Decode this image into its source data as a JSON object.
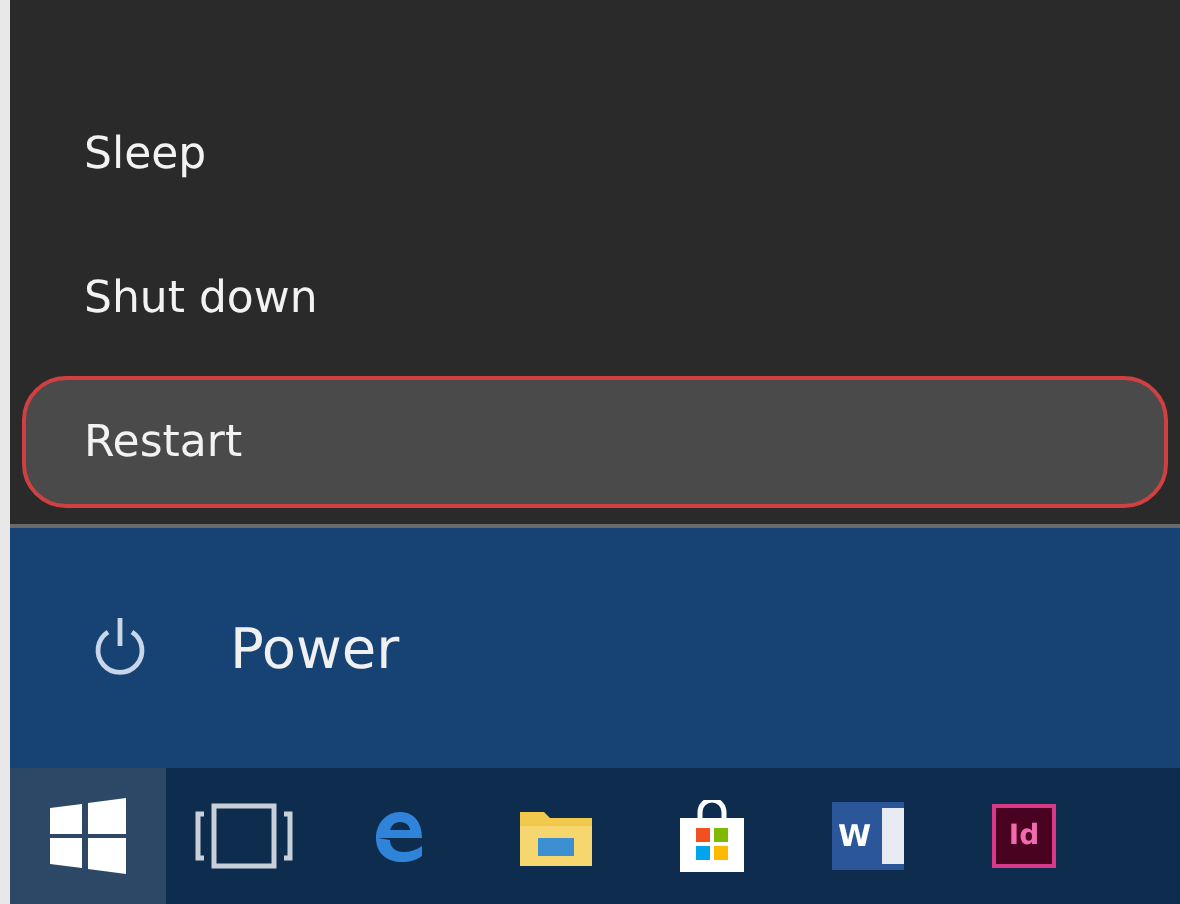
{
  "power_menu": {
    "items": [
      {
        "label": "Sleep",
        "selected": false
      },
      {
        "label": "Shut down",
        "selected": false
      },
      {
        "label": "Restart",
        "selected": true
      }
    ]
  },
  "power_button": {
    "label": "Power"
  },
  "taskbar": {
    "items": [
      {
        "kind": "start",
        "selected": true
      },
      {
        "kind": "task-view",
        "selected": false
      },
      {
        "kind": "edge",
        "selected": false
      },
      {
        "kind": "folder",
        "selected": false
      },
      {
        "kind": "store",
        "selected": false
      },
      {
        "kind": "word",
        "selected": false,
        "badge": "W"
      },
      {
        "kind": "indesign",
        "selected": false,
        "badge": "Id"
      }
    ]
  }
}
